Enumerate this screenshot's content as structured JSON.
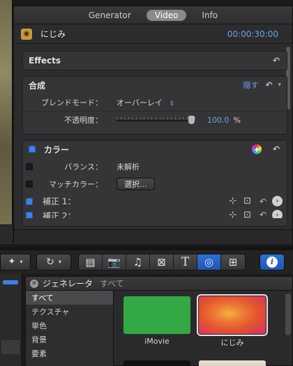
{
  "inspector": {
    "tabs": [
      {
        "label": "Generator",
        "active": false
      },
      {
        "label": "Video",
        "active": true
      },
      {
        "label": "Info",
        "active": false
      }
    ],
    "clip": {
      "name": "にじみ",
      "timecode": "00:00:30:00"
    },
    "effects": {
      "label": "Effects"
    },
    "composite": {
      "label": "合成",
      "hide_label": "隠す",
      "blend_mode_label": "ブレンドモード：",
      "blend_mode_value": "オーバーレイ",
      "opacity_label": "不透明度：",
      "opacity_value": "100.0",
      "opacity_unit": "%",
      "opacity_fraction": 1.0
    },
    "color": {
      "label": "カラー",
      "balance_label": "バランス：",
      "balance_value": "未解析",
      "match_label": "マッチカラー：",
      "match_button": "選択...",
      "correction1_label": "補正 1：",
      "correction2_label": "補正 2："
    }
  },
  "toolbar": {
    "media_buttons": [
      {
        "name": "clip-appearance",
        "glyph": "▤"
      },
      {
        "name": "photos",
        "glyph": "📷"
      },
      {
        "name": "music",
        "glyph": "♫"
      },
      {
        "name": "transitions",
        "glyph": "⊠"
      },
      {
        "name": "titles",
        "glyph": "T"
      },
      {
        "name": "generators",
        "glyph": "◎",
        "active": true
      },
      {
        "name": "themes",
        "glyph": "⊞"
      }
    ],
    "info_glyph": "i"
  },
  "generators": {
    "title": "ジェネレータ",
    "crumb": "すべて",
    "categories": [
      {
        "label": "すべて",
        "selected": true
      },
      {
        "label": "テクスチャ",
        "selected": false
      },
      {
        "label": "単色",
        "selected": false
      },
      {
        "label": "背景",
        "selected": false
      },
      {
        "label": "要素",
        "selected": false
      }
    ],
    "items": [
      {
        "label": "iMovie",
        "color": "#33a845"
      },
      {
        "label": "にじみ",
        "color": "#e4552e"
      }
    ]
  },
  "colors": {
    "accent_blue": "#3a83e6",
    "timecode_blue": "#6aa5e6"
  }
}
